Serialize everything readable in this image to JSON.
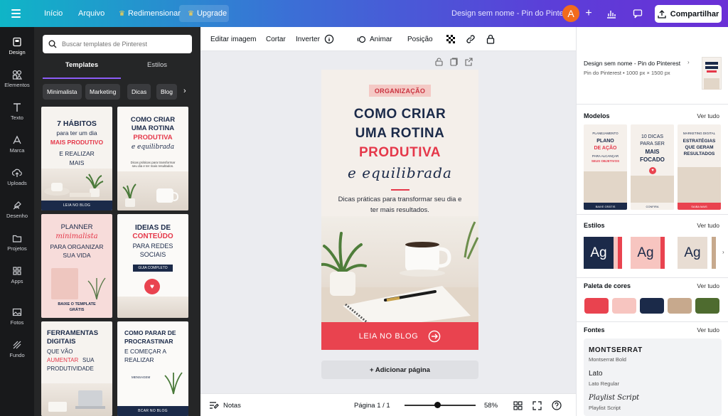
{
  "topbar": {
    "home": "Início",
    "file": "Arquivo",
    "resize": "Redimensionar",
    "upgrade": "Upgrade",
    "doc_title": "Design sem nome - Pin do Pinterest",
    "avatar_letter": "A",
    "share": "Compartilhar"
  },
  "sidenav": {
    "items": [
      {
        "label": "Design",
        "icon": "design-icon"
      },
      {
        "label": "Elementos",
        "icon": "elements-icon"
      },
      {
        "label": "Texto",
        "icon": "text-icon"
      },
      {
        "label": "Marca",
        "icon": "brand-icon"
      },
      {
        "label": "Uploads",
        "icon": "upload-icon"
      },
      {
        "label": "Desenho",
        "icon": "draw-icon"
      },
      {
        "label": "Projetos",
        "icon": "folder-icon"
      },
      {
        "label": "Apps",
        "icon": "apps-icon"
      },
      {
        "label": "Fotos",
        "icon": "photo-icon"
      },
      {
        "label": "Fundo",
        "icon": "background-icon"
      }
    ]
  },
  "panel": {
    "search_placeholder": "Buscar templates de Pinterest",
    "tabs": [
      "Templates",
      "Estilos"
    ],
    "chips": [
      "Minimalista",
      "Marketing",
      "Dicas",
      "Blog"
    ],
    "cards": [
      {
        "l1": "7 HÁBITOS",
        "l2": "para ter um dia",
        "l3": "MAIS PRODUTIVO",
        "l4": "E REALIZAR",
        "l5": "MAIS",
        "band": "LEIA NO BLOG"
      },
      {
        "l1": "COMO CRIAR",
        "l2": "UMA ROTINA",
        "l3": "PRODUTIVA",
        "l4": "e equilibrada",
        "l5": "Dicas práticas para transformar seu dia e ter mais resultados."
      },
      {
        "l1": "PLANNER",
        "l2": "minimalista",
        "l3": "PARA ORGANIZAR",
        "l4": "SUA VIDA",
        "l5": "BAIXE O TEMPLATE",
        "l6": "GRÁTIS"
      },
      {
        "l1": "IDEIAS DE",
        "l2": "CONTEÚDO",
        "l3": "PARA REDES",
        "l4": "SOCIAIS",
        "l5": "GUIA COMPLETO"
      },
      {
        "l1": "FERRAMENTAS",
        "l2": "DIGITAIS",
        "l3": "QUE VÃO",
        "l4": "AUMENTAR",
        "l5": "SUA",
        "l6": "PRODUTIVIDADE"
      },
      {
        "l1": "COMO PARAR DE",
        "l2": "PROCRASTINAR",
        "l3": "E COMEÇAR A",
        "l4": "REALIZAR",
        "l5": "MENSAGEM",
        "band": "BCAR NO BLOG"
      }
    ]
  },
  "toolbar": {
    "edit_image": "Editar imagem",
    "crop": "Cortar",
    "flip": "Inverter",
    "animate": "Animar",
    "position": "Posição"
  },
  "design": {
    "tag": "ORGANIZAÇÃO",
    "line1": "COMO CRIAR",
    "line2": "UMA ROTINA",
    "line3": "PRODUTIVA",
    "line4": "e equilibrada",
    "subtitle": "Dicas práticas para transformar seu dia e ter mais resultados.",
    "cta": "LEIA NO BLOG",
    "add_page": "+ Adicionar página"
  },
  "bottombar": {
    "notes": "Notas",
    "page": "Página 1 / 1",
    "zoom": "58%",
    "zoom_level": 0.58
  },
  "rpanel": {
    "doc_title": "Design sem nome - Pin do Pinterest",
    "doc_meta": "Pin do Pinterest • 1000 px × 1500 px",
    "models_title": "Modelos",
    "see_all": "Ver tudo",
    "models": [
      {
        "l1": "PLANEJAMENTO",
        "l2": "PLANO",
        "l3": "DE AÇÃO",
        "l4": "PARA ALCANÇAR",
        "l5": "SEUS OBJETIVOS",
        "band": "BAIXE GRÁTIS"
      },
      {
        "l1": "10 DICAS",
        "l2": "PARA SER",
        "l3": "MAIS",
        "l4": "FOCADO",
        "band": "CONFIRA"
      },
      {
        "l1": "MARKETING DIGITAL",
        "l2": "ESTRATÉGIAS",
        "l3": "QUE GERAM",
        "l4": "RESULTADOS",
        "band": "SAIBA MAIS"
      }
    ],
    "styles_title": "Estilos",
    "style_label": "Ag",
    "palette_title": "Paleta de cores",
    "palette": [
      "#e9434f",
      "#f7c5c0",
      "#1b2a49",
      "#c7a98d",
      "#4e6b2f"
    ],
    "fonts_title": "Fontes",
    "fonts": [
      {
        "name": "MONTSERRAT",
        "style": "Montserrat Bold"
      },
      {
        "name": "Lato",
        "style": "Lato Regular"
      },
      {
        "name": "Playlist Script",
        "style": "Playlist Script"
      }
    ]
  }
}
